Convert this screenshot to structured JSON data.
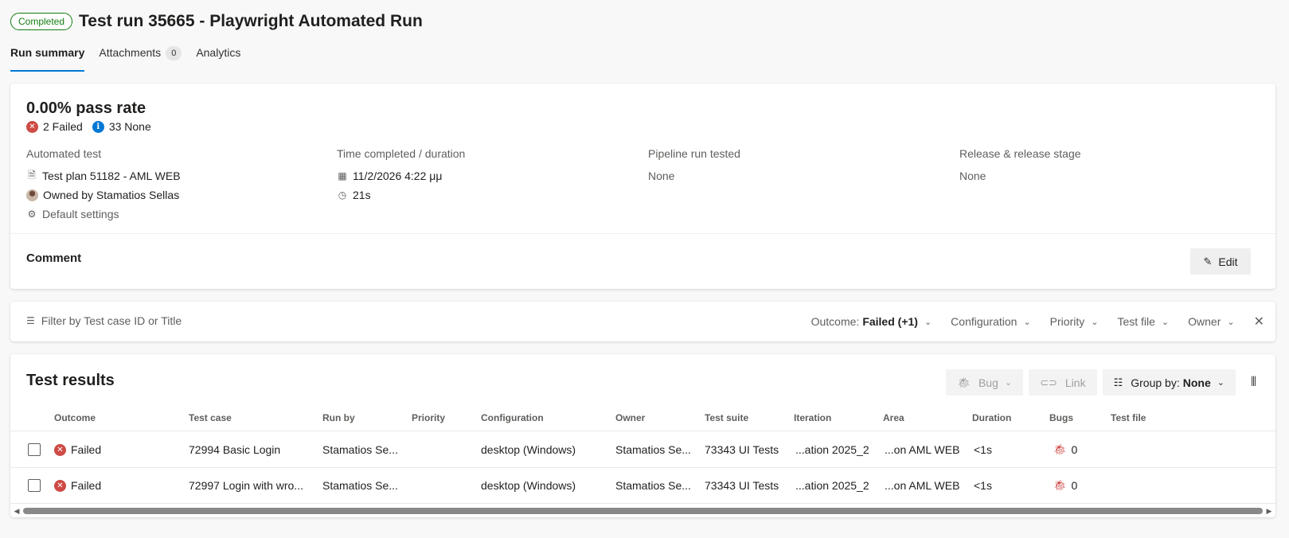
{
  "header": {
    "status": "Completed",
    "title": "Test run 35665 - Playwright Automated Run"
  },
  "tabs": [
    {
      "label": "Run summary",
      "active": true
    },
    {
      "label": "Attachments",
      "count": "0"
    },
    {
      "label": "Analytics"
    }
  ],
  "summary": {
    "pass_rate": "0.00% pass rate",
    "failed": "2 Failed",
    "none": "33 None",
    "automated_test": {
      "label": "Automated test",
      "test_plan": "Test plan 51182 - AML WEB",
      "owner": "Owned by Stamatios Sellas",
      "settings": "Default settings"
    },
    "time": {
      "label": "Time completed / duration",
      "completed": "11/2/2026 4:22 μμ",
      "duration": "21s"
    },
    "pipeline": {
      "label": "Pipeline run tested",
      "value": "None"
    },
    "release": {
      "label": "Release & release stage",
      "value": "None"
    },
    "comment": {
      "label": "Comment",
      "edit_label": "Edit"
    }
  },
  "filter": {
    "placeholder": "Filter by Test case ID or Title",
    "outcome_label": "Outcome:",
    "outcome_value": "Failed (+1)",
    "configuration": "Configuration",
    "priority": "Priority",
    "test_file": "Test file",
    "owner": "Owner"
  },
  "results": {
    "title": "Test results",
    "bug_label": "Bug",
    "link_label": "Link",
    "group_by_label": "Group by:",
    "group_by_value": "None",
    "columns": [
      "Outcome",
      "Test case",
      "Run by",
      "Priority",
      "Configuration",
      "Owner",
      "Test suite",
      "Iteration",
      "Area",
      "Duration",
      "Bugs",
      "Test file"
    ],
    "rows": [
      {
        "outcome": "Failed",
        "test_case": "72994 Basic Login",
        "run_by": "Stamatios Se...",
        "priority": "",
        "configuration": "desktop (Windows)",
        "owner": "Stamatios Se...",
        "test_suite": "73343 UI Tests",
        "iteration": "...ation 2025_2",
        "area": "...on AML WEB",
        "duration": "<1s",
        "bugs": "0",
        "test_file": ""
      },
      {
        "outcome": "Failed",
        "test_case": "72997 Login with wro...",
        "run_by": "Stamatios Se...",
        "priority": "",
        "configuration": "desktop (Windows)",
        "owner": "Stamatios Se...",
        "test_suite": "73343 UI Tests",
        "iteration": "...ation 2025_2",
        "area": "...on AML WEB",
        "duration": "<1s",
        "bugs": "0",
        "test_file": ""
      }
    ]
  },
  "colors": {
    "accent": "#0078d4",
    "success": "#107c10",
    "failed": "#cd4a45"
  }
}
